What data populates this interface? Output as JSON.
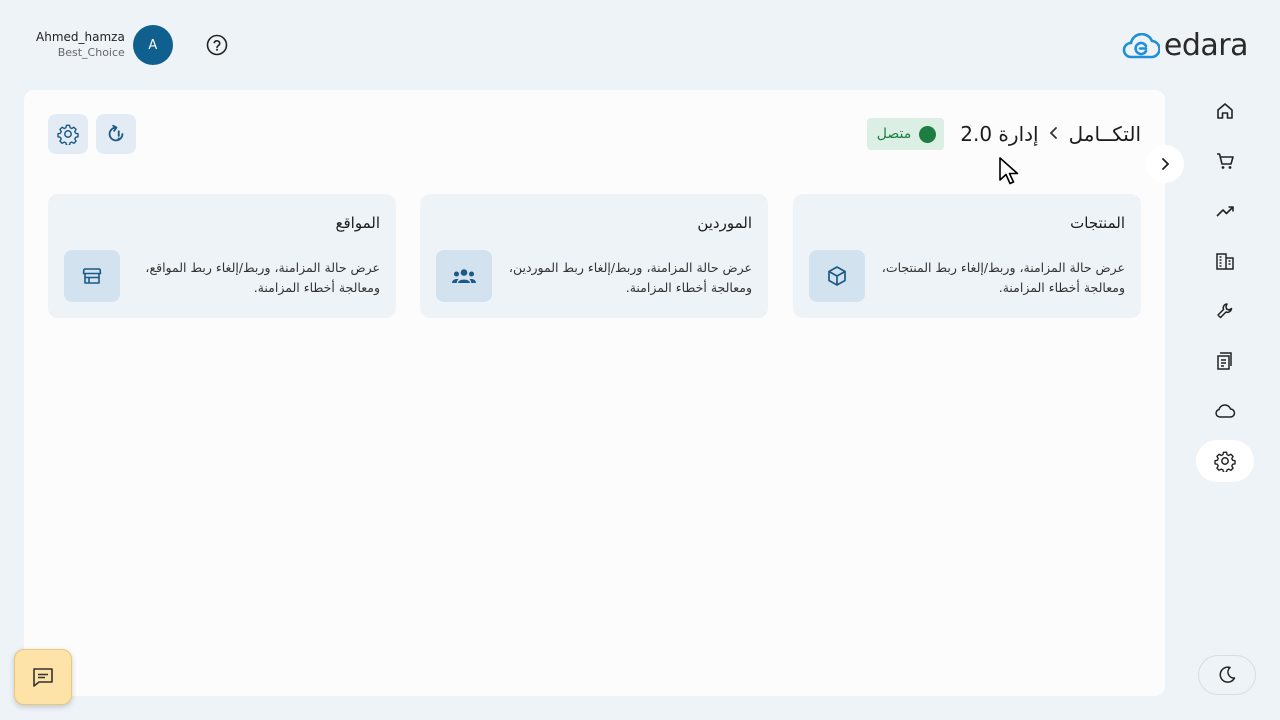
{
  "user": {
    "name": "Ahmed_hamza",
    "org": "Best_Choice",
    "avatar_letter": "A"
  },
  "logo": {
    "text": "edara"
  },
  "breadcrumb": {
    "root": "التكــامل",
    "current": "إدارة 2.0"
  },
  "status": {
    "label": "متصل",
    "color": "#1e7e42"
  },
  "cards": [
    {
      "title": "المنتجات",
      "description": "عرض حالة المزامنة، وربط/إلغاء ربط المنتجات، ومعالجة أخطاء المزامنة.",
      "icon": "box-icon"
    },
    {
      "title": "الموردين",
      "description": "عرض حالة المزامنة، وربط/إلغاء ربط الموردين، ومعالجة أخطاء المزامنة.",
      "icon": "group-icon"
    },
    {
      "title": "المواقع",
      "description": "عرض حالة المزامنة، وربط/إلغاء ربط المواقع، ومعالجة أخطاء المزامنة.",
      "icon": "store-icon"
    }
  ],
  "nav": [
    "home-icon",
    "cart-icon",
    "trending-icon",
    "building-icon",
    "wrench-icon",
    "receipt-icon",
    "cloud-icon",
    "settings-icon"
  ],
  "nav_active": "settings-icon",
  "colors": {
    "accent": "#0f5f8f",
    "background": "#eef3f8",
    "icon": "#1c5a86"
  }
}
